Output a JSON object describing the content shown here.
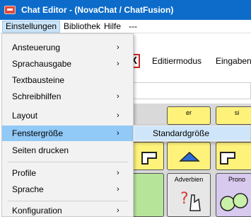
{
  "window": {
    "title": "Chat Editor - (NovaChat / ChatFusion)",
    "icon": "app-icon"
  },
  "menubar": {
    "items": [
      {
        "label": "Einstellungen"
      },
      {
        "label": "Bibliothek"
      },
      {
        "label": "Hilfe"
      },
      {
        "label": "---"
      }
    ]
  },
  "background": {
    "toolbar_close": "X",
    "toolbar_items": [
      "Editiermodus",
      "Eingaben"
    ],
    "cells": [
      "er",
      "si",
      "Adverbien",
      "Prono"
    ]
  },
  "dropdown": {
    "items": [
      {
        "label": "Ansteuerung",
        "arrow": "›"
      },
      {
        "label": "Sprachausgabe",
        "arrow": "›"
      },
      {
        "label": "Textbausteine",
        "arrow": ""
      },
      {
        "label": "Schreibhilfen",
        "arrow": "›"
      },
      {
        "label": "Layout",
        "arrow": "›"
      },
      {
        "label": "Fenstergröße",
        "arrow": "›"
      },
      {
        "label": "Seiten drucken",
        "arrow": ""
      },
      {
        "label": "Profile",
        "arrow": "›"
      },
      {
        "label": "Sprache",
        "arrow": "›"
      },
      {
        "label": "Konfiguration",
        "arrow": "›"
      }
    ]
  },
  "submenu": {
    "items": [
      {
        "label": "Standardgröße"
      }
    ]
  },
  "colors": {
    "titlebar": "#0d6cc9",
    "menu_highlight": "#91c9f7",
    "submenu_highlight": "#cfe6fa"
  }
}
